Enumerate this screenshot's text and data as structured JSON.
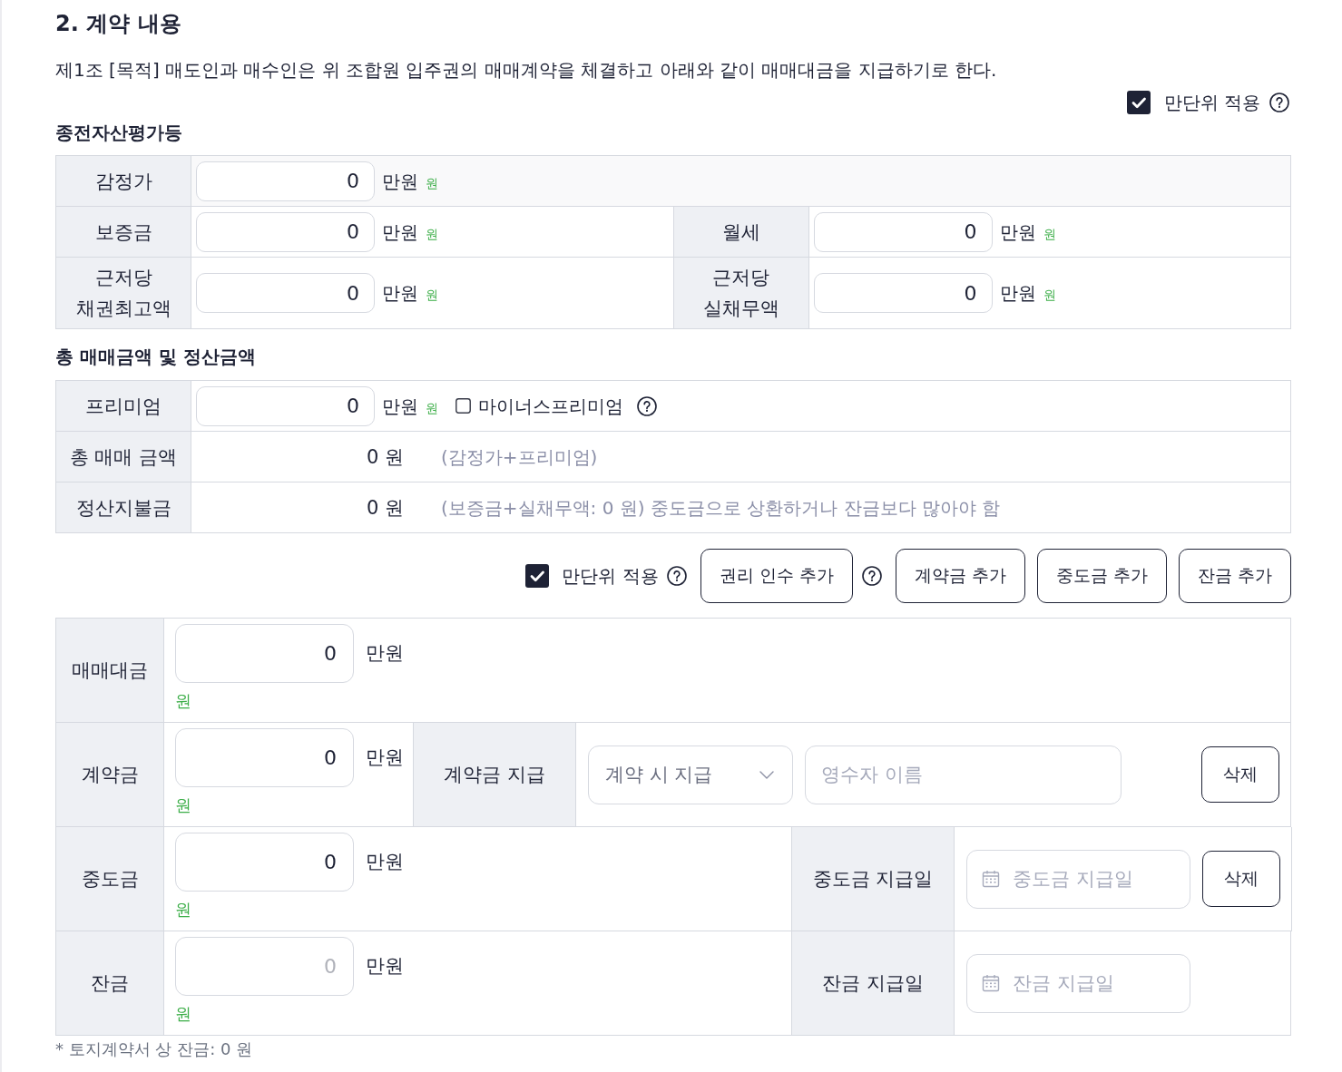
{
  "section": {
    "title": "2. 계약 내용",
    "article": "제1조 [목적] 매도인과 매수인은 위 조합원 입주권의 매매계약을 체결하고 아래와 같이 매매대금을 지급하기로 한다."
  },
  "unit_toggle": {
    "label": "만단위 적용",
    "checked": true,
    "help": true
  },
  "prior_assets": {
    "title": "종전자산평가등",
    "rows": [
      {
        "cells": [
          {
            "label": "감정가",
            "value": "0",
            "unit": "만원",
            "sub_unit": "원"
          }
        ]
      },
      {
        "cells": [
          {
            "label": "보증금",
            "value": "0",
            "unit": "만원",
            "sub_unit": "원"
          },
          {
            "label": "월세",
            "value": "0",
            "unit": "만원",
            "sub_unit": "원"
          }
        ]
      },
      {
        "cells": [
          {
            "label": "근저당 채권최고액",
            "value": "0",
            "unit": "만원",
            "sub_unit": "원"
          },
          {
            "label": "근저당 실채무액",
            "value": "0",
            "unit": "만원",
            "sub_unit": "원"
          }
        ]
      }
    ]
  },
  "totals": {
    "title": "총 매매금액 및 정산금액",
    "rows": [
      {
        "kind": "input",
        "label": "프리미엄",
        "value": "0",
        "unit": "만원",
        "sub_unit": "원",
        "checkbox": {
          "label": "마이너스프리미엄",
          "checked": false,
          "help": true
        }
      },
      {
        "kind": "amount",
        "label": "총 매매 금액",
        "amount": "0 원",
        "note": "(감정가+프리미엄)"
      },
      {
        "kind": "amount",
        "label": "정산지불금",
        "amount": "0 원",
        "note": "(보증금+실채무액: 0 원) 중도금으로 상환하거나 잔금보다 많아야 함"
      }
    ]
  },
  "toolbar": {
    "unit_toggle": {
      "label": "만단위 적용",
      "checked": true,
      "help": true
    },
    "buttons": [
      {
        "label": "권리 인수 추가",
        "help": true
      },
      {
        "label": "계약금 추가"
      },
      {
        "label": "중도금 추가"
      },
      {
        "label": "잔금 추가"
      }
    ]
  },
  "payments": {
    "rows": [
      {
        "kind": "amount",
        "label": "매매대금",
        "value": "0",
        "unit": "만원",
        "sub_unit": "원"
      },
      {
        "kind": "select",
        "label": "계약금",
        "value": "0",
        "unit": "만원",
        "sub_unit": "원",
        "detail_label": "계약금 지급",
        "select_value": "계약 시 지급",
        "name_placeholder": "영수자 이름",
        "delete": "삭제"
      },
      {
        "kind": "date",
        "label": "중도금",
        "value": "0",
        "unit": "만원",
        "sub_unit": "원",
        "detail_label": "중도금 지급일",
        "date_placeholder": "중도금 지급일",
        "delete": "삭제"
      },
      {
        "kind": "date",
        "label": "잔금",
        "placeholder": "0",
        "unit": "만원",
        "sub_unit": "원",
        "detail_label": "잔금 지급일",
        "date_placeholder": "잔금 지급일"
      }
    ]
  },
  "footnote": "* 토지계약서 상 잔금: 0 원"
}
